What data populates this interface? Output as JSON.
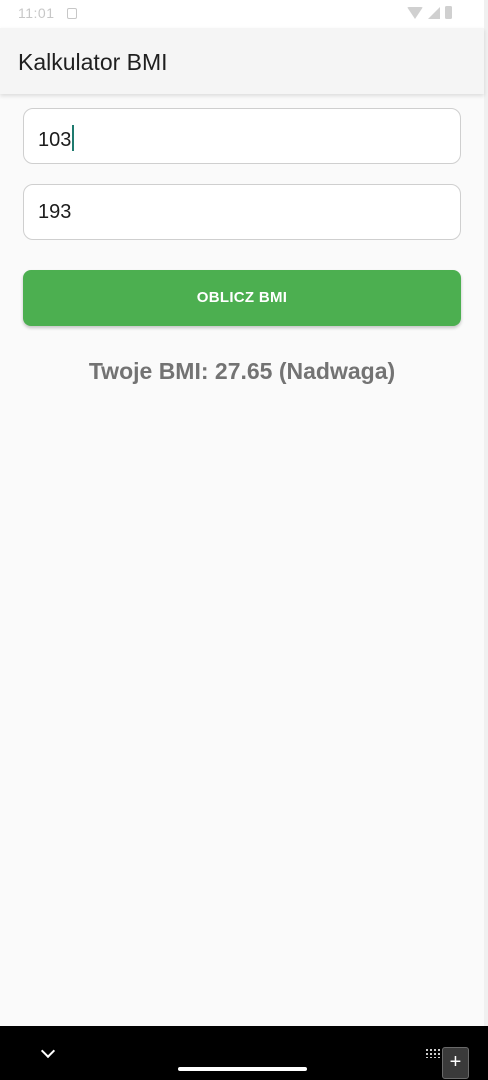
{
  "status_bar": {
    "time": "11:01",
    "icons": [
      "notification-icon",
      "wifi-icon",
      "signal-icon",
      "battery-icon"
    ]
  },
  "app_bar": {
    "title": "Kalkulator BMI"
  },
  "form": {
    "weight_value": "103",
    "height_value": "193",
    "calculate_label": "OBLICZ BMI"
  },
  "result": {
    "text": "Twoje BMI: 27.65 (Nadwaga)"
  },
  "nav_bar": {
    "add_symbol": "+",
    "icons": [
      "chevron-down-icon",
      "keyboard-icon",
      "add-icon"
    ]
  },
  "colors": {
    "accent": "#4caf50",
    "background": "#fafafa",
    "app_bar": "#f5f5f5",
    "result_text": "#737373",
    "caret": "#1e7a6e"
  }
}
